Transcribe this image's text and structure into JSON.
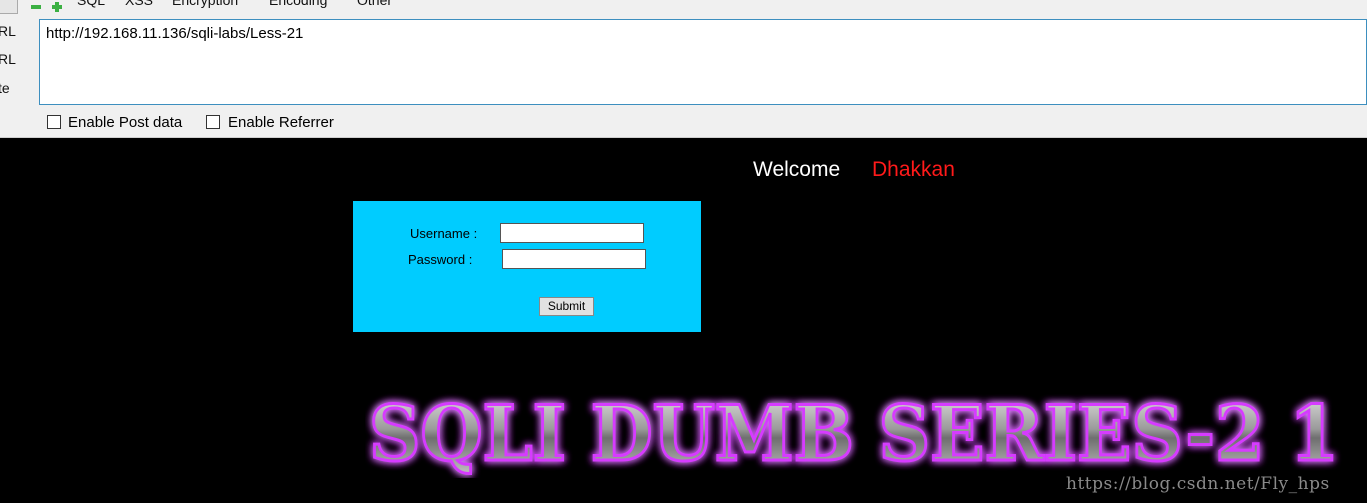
{
  "menubar": {
    "items": [
      {
        "label": "SQL"
      },
      {
        "label": "XSS"
      },
      {
        "label": "Encryption"
      },
      {
        "label": "Encoding"
      },
      {
        "label": "Other"
      }
    ],
    "caret": "▾"
  },
  "side_labels": [
    "RL",
    "RL",
    "te"
  ],
  "url": {
    "value": "http://192.168.11.136/sqli-labs/Less-21"
  },
  "options": {
    "post_data_label": "Enable Post data",
    "referrer_label": "Enable Referrer"
  },
  "page": {
    "welcome": "Welcome",
    "username_display": "Dhakkan",
    "form": {
      "username_label": "Username :",
      "password_label": "Password :",
      "submit_label": "Submit"
    },
    "banner_text": "SQLI DUMB SERIES-2 1"
  },
  "watermark": "https://blog.csdn.net/Fly_hps",
  "colors": {
    "form_bg": "#00ccff",
    "accent_red": "#ff1a1a",
    "banner_glow": "#d63bff",
    "page_bg": "#000000"
  }
}
